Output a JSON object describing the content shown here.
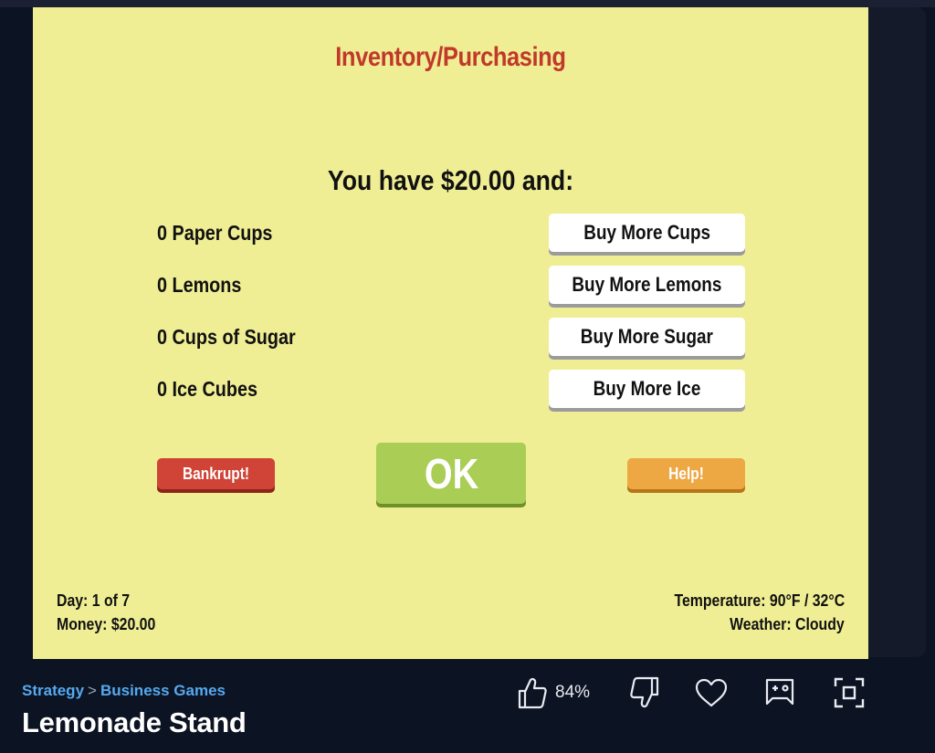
{
  "game": {
    "title": "Inventory/Purchasing",
    "money_line": "You have $20.00 and:",
    "inventory": [
      {
        "label": "0 Paper Cups",
        "button": "Buy More Cups"
      },
      {
        "label": "0 Lemons",
        "button": "Buy More Lemons"
      },
      {
        "label": "0 Cups of Sugar",
        "button": "Buy More Sugar"
      },
      {
        "label": "0 Ice Cubes",
        "button": "Buy More Ice"
      }
    ],
    "buttons": {
      "bankrupt": "Bankrupt!",
      "ok": "OK",
      "help": "Help!"
    },
    "status": {
      "day": "Day: 1 of 7",
      "money": "Money: $20.00",
      "temperature": "Temperature: 90°F / 32°C",
      "weather": "Weather: Cloudy"
    },
    "colors": {
      "background": "#f0ee94",
      "title": "#c0392b",
      "ok": "#a9cd55",
      "bankrupt": "#cf4437",
      "help": "#eda743"
    }
  },
  "page": {
    "breadcrumb": {
      "category": "Strategy",
      "separator": ">",
      "subcategory": "Business Games"
    },
    "game_name": "Lemonade Stand",
    "rating": "84%",
    "actions": [
      "thumbs-up-icon",
      "thumbs-down-icon",
      "heart-icon",
      "gamepad-icon",
      "fullscreen-icon"
    ],
    "colors": {
      "background": "#0c1322",
      "link": "#55a9f0"
    }
  }
}
